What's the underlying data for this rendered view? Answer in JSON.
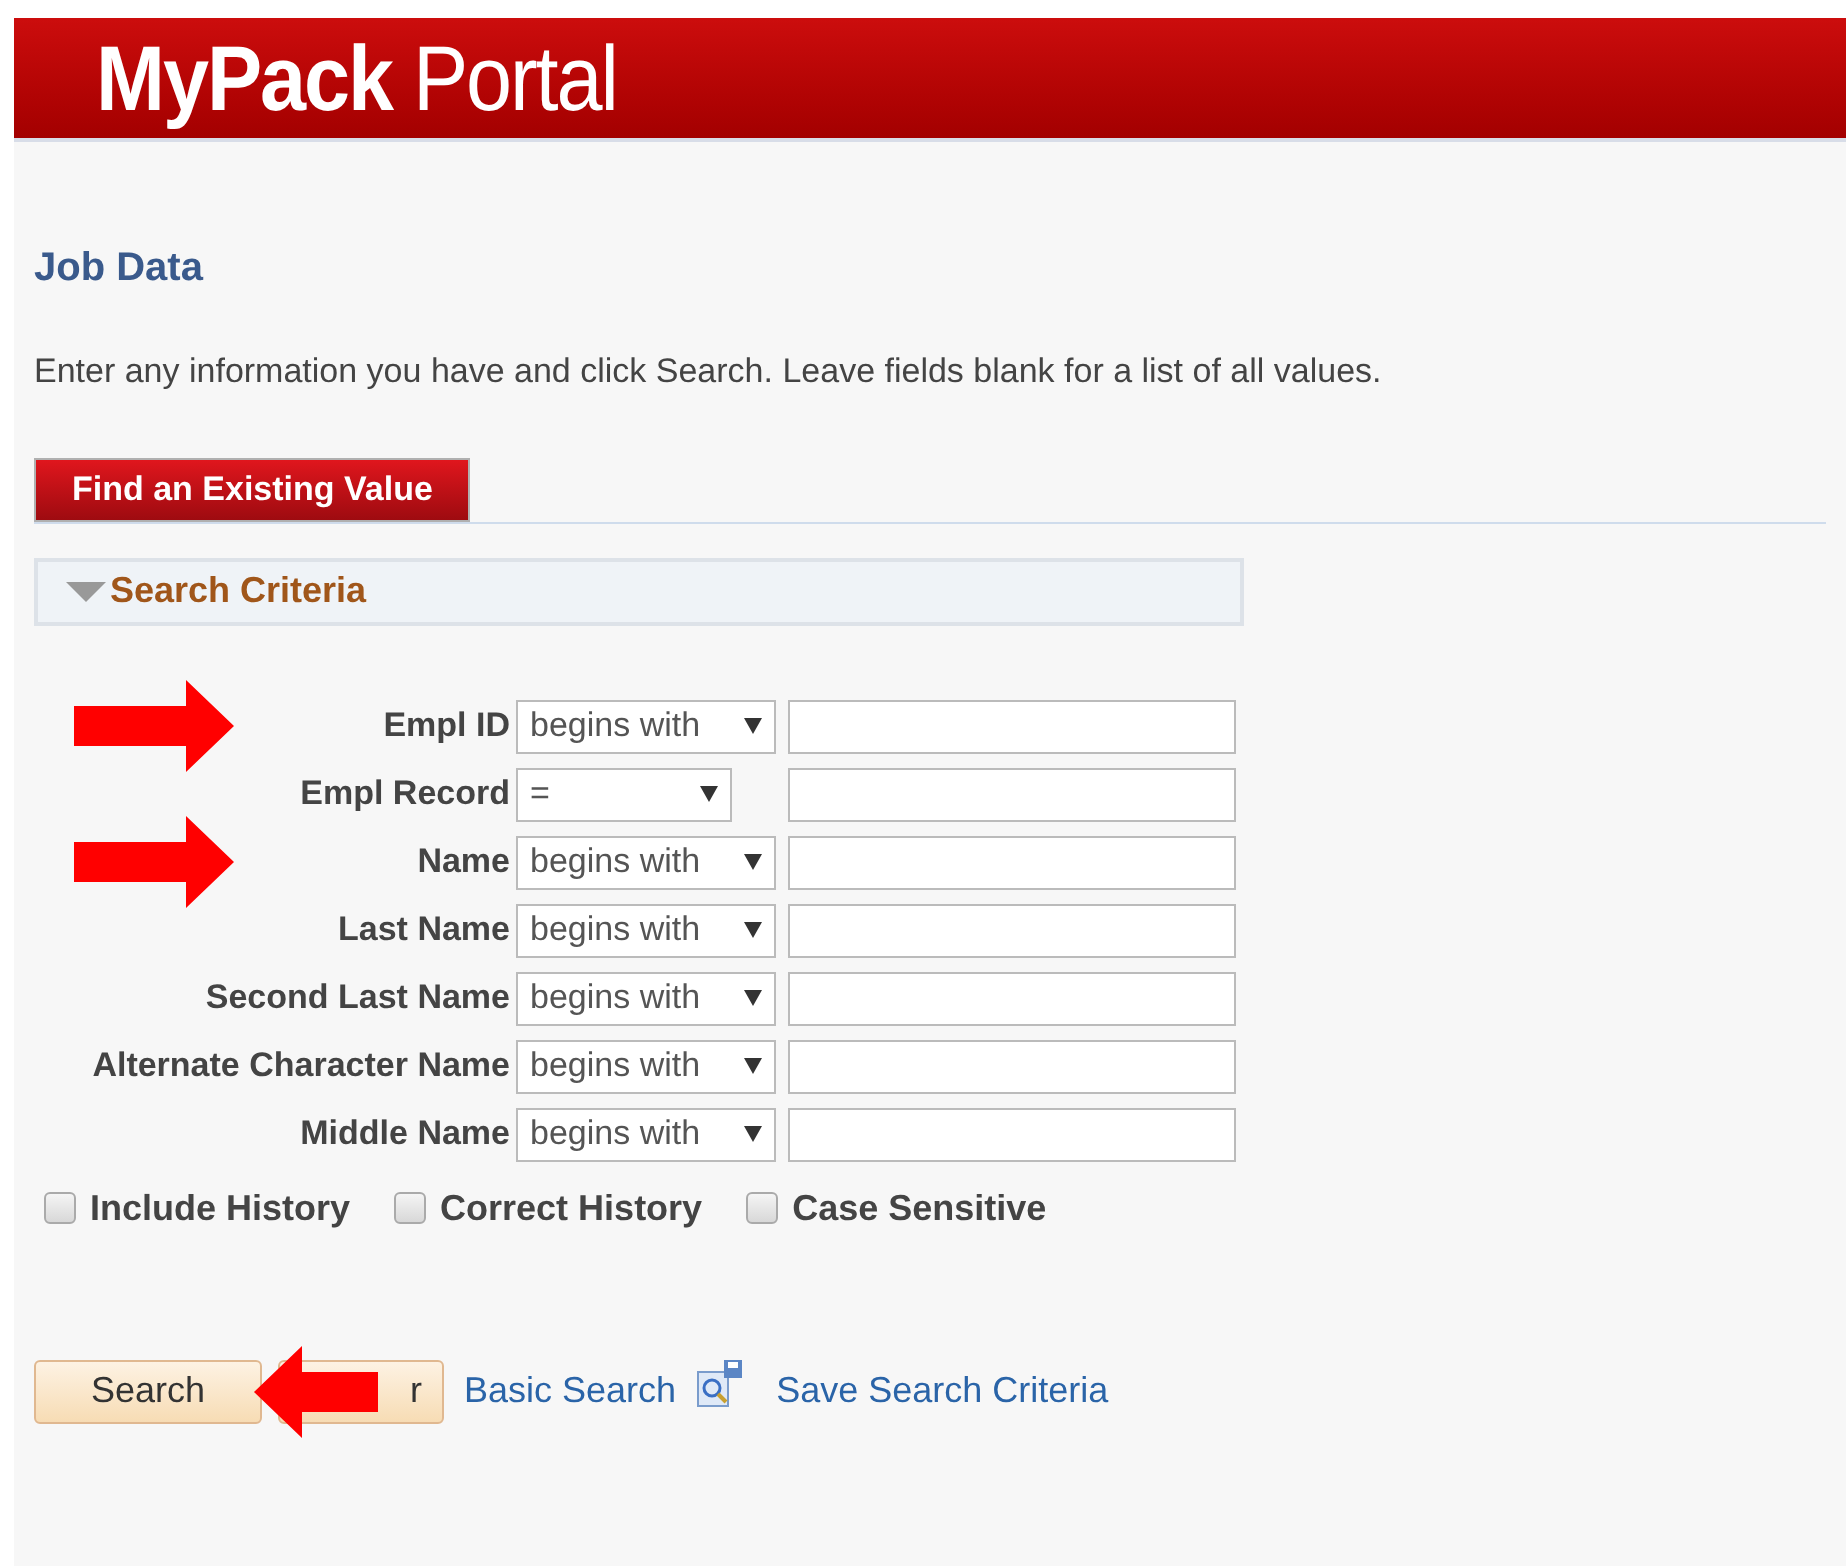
{
  "header": {
    "title_bold": "MyPack",
    "title_light": "Portal"
  },
  "page": {
    "title": "Job Data",
    "instructions": "Enter any information you have and click Search. Leave fields blank for a list of all values."
  },
  "tabs": [
    {
      "label": "Find an Existing Value",
      "selected": true
    }
  ],
  "section": {
    "title": "Search Criteria",
    "expanded": true
  },
  "fields": [
    {
      "label": "Empl ID",
      "operator": "begins with",
      "narrow": false,
      "marked": true
    },
    {
      "label": "Empl Record",
      "operator": "=",
      "narrow": true,
      "marked": false
    },
    {
      "label": "Name",
      "operator": "begins with",
      "narrow": false,
      "marked": true
    },
    {
      "label": "Last Name",
      "operator": "begins with",
      "narrow": false,
      "marked": false
    },
    {
      "label": "Second Last Name",
      "operator": "begins with",
      "narrow": false,
      "marked": false
    },
    {
      "label": "Alternate Character Name",
      "operator": "begins with",
      "narrow": false,
      "marked": false
    },
    {
      "label": "Middle Name",
      "operator": "begins with",
      "narrow": false,
      "marked": false
    }
  ],
  "options": [
    {
      "label": "Include History",
      "checked": false
    },
    {
      "label": "Correct History",
      "checked": false
    },
    {
      "label": "Case Sensitive",
      "checked": false
    }
  ],
  "buttons": [
    {
      "label": "Search",
      "marked": true
    },
    {
      "label": "r",
      "marked": false
    }
  ],
  "links": [
    {
      "label": "Basic Search",
      "kind": "text"
    },
    {
      "label": "Save Search Criteria",
      "kind": "icon"
    }
  ]
}
